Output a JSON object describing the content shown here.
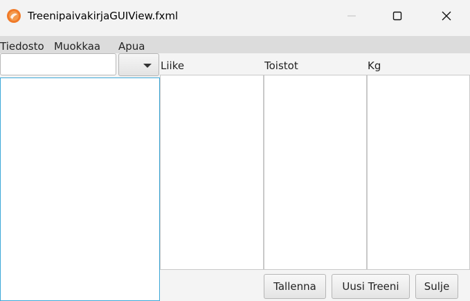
{
  "window": {
    "title": "TreenipaivakirjaGUIView.fxml",
    "icon": "app-icon",
    "controls": [
      "minimize-icon",
      "maximize-icon",
      "close-icon"
    ]
  },
  "menu": [
    "Tiedosto",
    "Muokkaa",
    "Apua"
  ],
  "left": {
    "search_value": "",
    "combo_selected": ""
  },
  "table": {
    "columns": [
      "Liike",
      "Toistot",
      "Kg"
    ]
  },
  "buttons": {
    "save": "Tallenna",
    "new": "Uusi Treeni",
    "close": "Sulje"
  },
  "colors": {
    "titlebar_bg": "#f3f3f3",
    "menubar_bg": "#dcdcdc",
    "list_focus_border": "#3ba7d8",
    "app_icon": "#f07a28"
  }
}
